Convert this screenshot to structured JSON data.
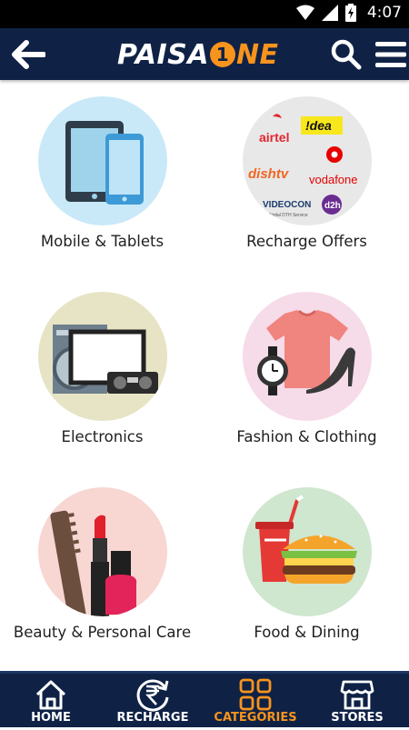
{
  "status_bar": {
    "time": "4:07"
  },
  "app_bar": {
    "logo": {
      "part1": "PAISA",
      "part2": "1",
      "part3": "NE"
    }
  },
  "categories": [
    {
      "label": "Mobile & Tablets",
      "bg": "#c9e9f8"
    },
    {
      "label": "Recharge Offers",
      "bg": "#e8e8e8",
      "brands": [
        "airtel",
        "!dea",
        "dishtv",
        "vodafone",
        "VIDEOCON",
        "d2h",
        "Digital DTH Service"
      ]
    },
    {
      "label": "Electronics",
      "bg": "#e6e4c4"
    },
    {
      "label": "Fashion & Clothing",
      "bg": "#f6dbe9"
    },
    {
      "label": "Beauty & Personal Care",
      "bg": "#f8d6d2"
    },
    {
      "label": "Food & Dining",
      "bg": "#cfe6cf"
    }
  ],
  "bottom_nav": [
    {
      "label": "HOME",
      "active": false
    },
    {
      "label": "RECHARGE",
      "active": false
    },
    {
      "label": "CATEGORIES",
      "active": true
    },
    {
      "label": "STORES",
      "active": false
    }
  ],
  "colors": {
    "primary": "#0f2246",
    "accent": "#f7941d"
  }
}
